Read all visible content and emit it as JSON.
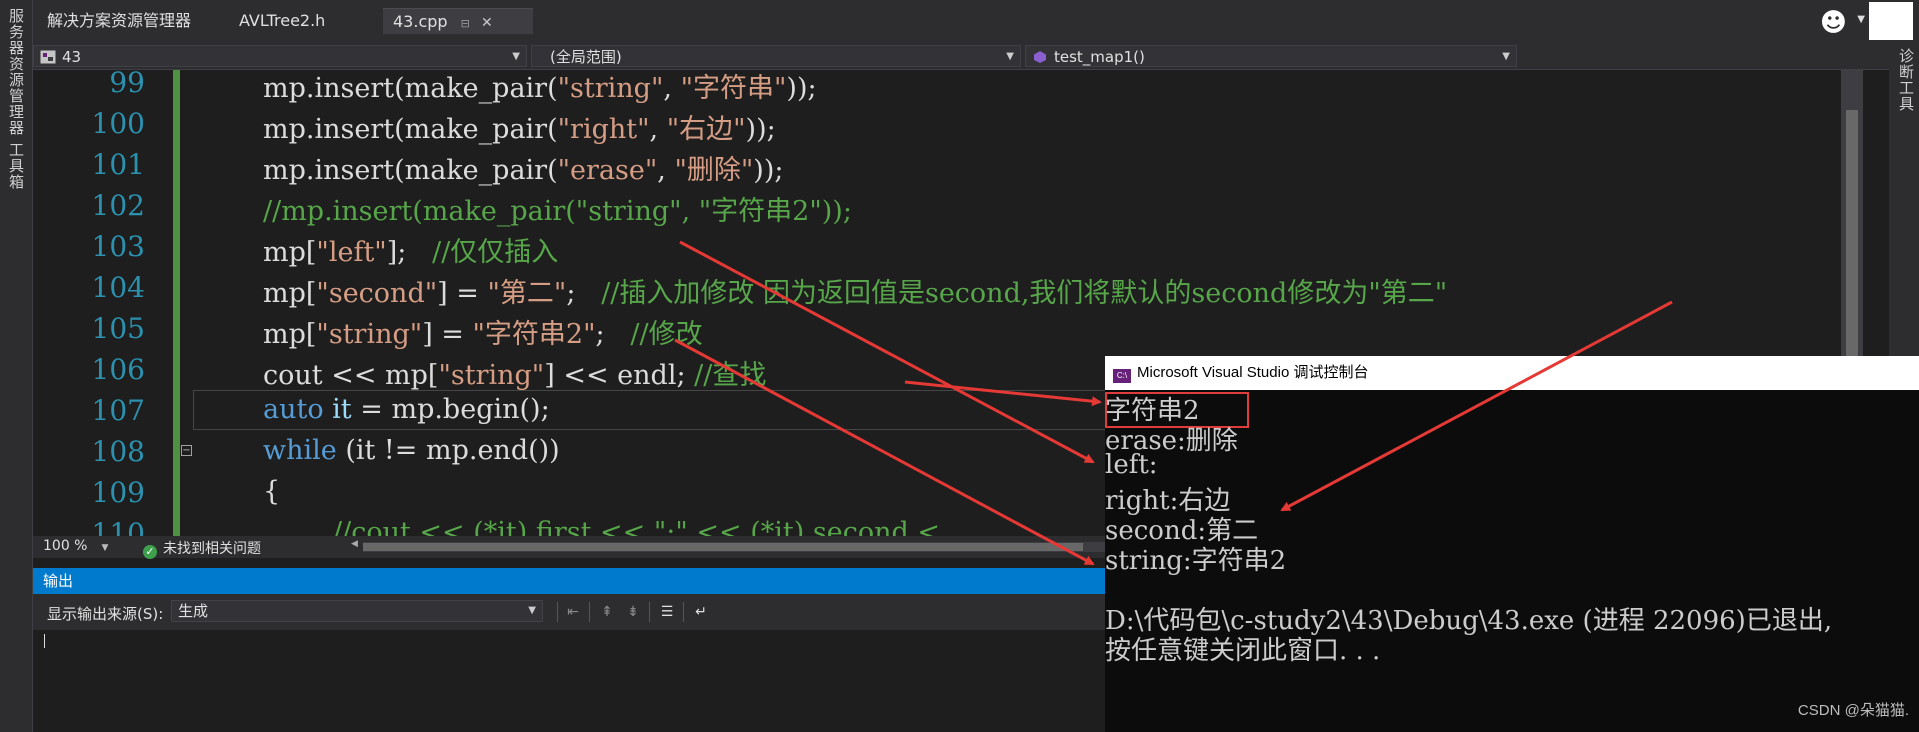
{
  "left_strip": {
    "items": [
      "服务器资源管理器",
      "工具箱"
    ]
  },
  "right_strip": {
    "label": "诊断工具"
  },
  "tabs": [
    {
      "label": "解决方案资源管理器"
    },
    {
      "label": "AVLTree2.h"
    },
    {
      "label": "43.cpp",
      "pin": "⊟",
      "close": "✕"
    }
  ],
  "navbar": {
    "project": "43",
    "scope": "(全局范围)",
    "function": "test_map1()"
  },
  "editor": {
    "line_numbers": [
      "99",
      "100",
      "101",
      "102",
      "103",
      "104",
      "105",
      "106",
      "107",
      "108",
      "109",
      "110"
    ],
    "lines": {
      "l99_pre": "mp.insert(make_pair(",
      "l99_s1": "\"string\"",
      "l99_mid": ", ",
      "l99_s2": "\"字符串\"",
      "l99_post": "));",
      "l100_pre": "mp.insert(make_pair(",
      "l100_s1": "\"right\"",
      "l100_mid": ", ",
      "l100_s2": "\"右边\"",
      "l100_post": "));",
      "l101_pre": "mp.insert(make_pair(",
      "l101_s1": "\"erase\"",
      "l101_mid": ", ",
      "l101_s2": "\"删除\"",
      "l101_post": "));",
      "l102": "//mp.insert(make_pair(\"string\", \"字符串2\"));",
      "l103_pre": "mp[",
      "l103_s1": "\"left\"",
      "l103_post": "];   ",
      "l103_cmt": "//仅仅插入",
      "l104_pre": "mp[",
      "l104_s1": "\"second\"",
      "l104_mid": "] = ",
      "l104_s2": "\"第二\"",
      "l104_post": ";   ",
      "l104_cmt": "//插入加修改 因为返回值是second,我们将默认的second修改为\"第二\"",
      "l105_pre": "mp[",
      "l105_s1": "\"string\"",
      "l105_mid": "] = ",
      "l105_s2": "\"字符串2\"",
      "l105_post": ";   ",
      "l105_cmt": "//修改",
      "l106_pre": "cout << mp[",
      "l106_s1": "\"string\"",
      "l106_post": "] << endl; ",
      "l106_cmt": "//查找",
      "l107_kw": "auto",
      "l107_var": " it",
      "l107_rest": " = mp.begin();",
      "l108_kw": "while",
      "l108_rest": " (it != mp.end())",
      "l109": "{",
      "l110": "//cout << (*it).first << \":\" << (*it).second <"
    }
  },
  "status": {
    "zoom": "100 %",
    "issues": "未找到相关问题"
  },
  "output": {
    "title": "输出",
    "source_label": "显示输出来源(S):",
    "source_value": "生成"
  },
  "console": {
    "title": "Microsoft Visual Studio 调试控制台",
    "icon": "C:\\",
    "lines": [
      "字符串2",
      "erase:删除",
      "left:",
      "right:右边",
      "second:第二",
      "string:字符串2",
      "",
      "D:\\代码包\\c-study2\\43\\Debug\\43.exe (进程 22096)已退出,",
      "按任意键关闭此窗口. . ."
    ]
  },
  "watermark": "CSDN @朵猫猫.",
  "colors": {
    "keyword": "#569cd6",
    "string": "#d69d85",
    "comment": "#57a64a",
    "accent": "#007acc",
    "arrow": "#e53935"
  }
}
